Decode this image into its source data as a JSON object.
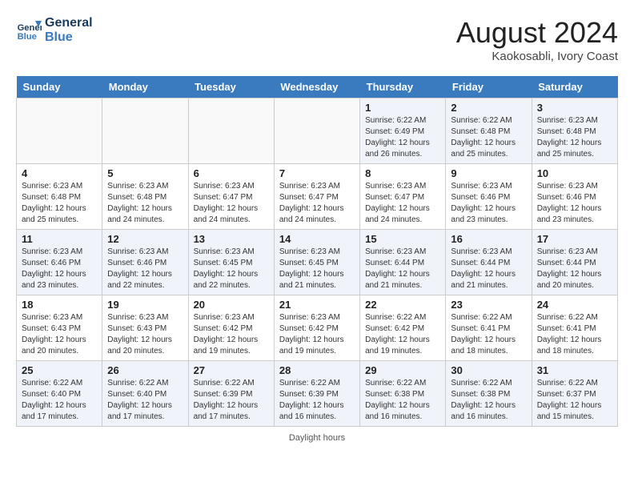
{
  "header": {
    "logo_line1": "General",
    "logo_line2": "Blue",
    "month_year": "August 2024",
    "location": "Kaokosabli, Ivory Coast"
  },
  "days_of_week": [
    "Sunday",
    "Monday",
    "Tuesday",
    "Wednesday",
    "Thursday",
    "Friday",
    "Saturday"
  ],
  "weeks": [
    [
      {
        "day": "",
        "info": ""
      },
      {
        "day": "",
        "info": ""
      },
      {
        "day": "",
        "info": ""
      },
      {
        "day": "",
        "info": ""
      },
      {
        "day": "1",
        "info": "Sunrise: 6:22 AM\nSunset: 6:49 PM\nDaylight: 12 hours\nand 26 minutes."
      },
      {
        "day": "2",
        "info": "Sunrise: 6:22 AM\nSunset: 6:48 PM\nDaylight: 12 hours\nand 25 minutes."
      },
      {
        "day": "3",
        "info": "Sunrise: 6:23 AM\nSunset: 6:48 PM\nDaylight: 12 hours\nand 25 minutes."
      }
    ],
    [
      {
        "day": "4",
        "info": "Sunrise: 6:23 AM\nSunset: 6:48 PM\nDaylight: 12 hours\nand 25 minutes."
      },
      {
        "day": "5",
        "info": "Sunrise: 6:23 AM\nSunset: 6:48 PM\nDaylight: 12 hours\nand 24 minutes."
      },
      {
        "day": "6",
        "info": "Sunrise: 6:23 AM\nSunset: 6:47 PM\nDaylight: 12 hours\nand 24 minutes."
      },
      {
        "day": "7",
        "info": "Sunrise: 6:23 AM\nSunset: 6:47 PM\nDaylight: 12 hours\nand 24 minutes."
      },
      {
        "day": "8",
        "info": "Sunrise: 6:23 AM\nSunset: 6:47 PM\nDaylight: 12 hours\nand 24 minutes."
      },
      {
        "day": "9",
        "info": "Sunrise: 6:23 AM\nSunset: 6:46 PM\nDaylight: 12 hours\nand 23 minutes."
      },
      {
        "day": "10",
        "info": "Sunrise: 6:23 AM\nSunset: 6:46 PM\nDaylight: 12 hours\nand 23 minutes."
      }
    ],
    [
      {
        "day": "11",
        "info": "Sunrise: 6:23 AM\nSunset: 6:46 PM\nDaylight: 12 hours\nand 23 minutes."
      },
      {
        "day": "12",
        "info": "Sunrise: 6:23 AM\nSunset: 6:46 PM\nDaylight: 12 hours\nand 22 minutes."
      },
      {
        "day": "13",
        "info": "Sunrise: 6:23 AM\nSunset: 6:45 PM\nDaylight: 12 hours\nand 22 minutes."
      },
      {
        "day": "14",
        "info": "Sunrise: 6:23 AM\nSunset: 6:45 PM\nDaylight: 12 hours\nand 21 minutes."
      },
      {
        "day": "15",
        "info": "Sunrise: 6:23 AM\nSunset: 6:44 PM\nDaylight: 12 hours\nand 21 minutes."
      },
      {
        "day": "16",
        "info": "Sunrise: 6:23 AM\nSunset: 6:44 PM\nDaylight: 12 hours\nand 21 minutes."
      },
      {
        "day": "17",
        "info": "Sunrise: 6:23 AM\nSunset: 6:44 PM\nDaylight: 12 hours\nand 20 minutes."
      }
    ],
    [
      {
        "day": "18",
        "info": "Sunrise: 6:23 AM\nSunset: 6:43 PM\nDaylight: 12 hours\nand 20 minutes."
      },
      {
        "day": "19",
        "info": "Sunrise: 6:23 AM\nSunset: 6:43 PM\nDaylight: 12 hours\nand 20 minutes."
      },
      {
        "day": "20",
        "info": "Sunrise: 6:23 AM\nSunset: 6:42 PM\nDaylight: 12 hours\nand 19 minutes."
      },
      {
        "day": "21",
        "info": "Sunrise: 6:23 AM\nSunset: 6:42 PM\nDaylight: 12 hours\nand 19 minutes."
      },
      {
        "day": "22",
        "info": "Sunrise: 6:22 AM\nSunset: 6:42 PM\nDaylight: 12 hours\nand 19 minutes."
      },
      {
        "day": "23",
        "info": "Sunrise: 6:22 AM\nSunset: 6:41 PM\nDaylight: 12 hours\nand 18 minutes."
      },
      {
        "day": "24",
        "info": "Sunrise: 6:22 AM\nSunset: 6:41 PM\nDaylight: 12 hours\nand 18 minutes."
      }
    ],
    [
      {
        "day": "25",
        "info": "Sunrise: 6:22 AM\nSunset: 6:40 PM\nDaylight: 12 hours\nand 17 minutes."
      },
      {
        "day": "26",
        "info": "Sunrise: 6:22 AM\nSunset: 6:40 PM\nDaylight: 12 hours\nand 17 minutes."
      },
      {
        "day": "27",
        "info": "Sunrise: 6:22 AM\nSunset: 6:39 PM\nDaylight: 12 hours\nand 17 minutes."
      },
      {
        "day": "28",
        "info": "Sunrise: 6:22 AM\nSunset: 6:39 PM\nDaylight: 12 hours\nand 16 minutes."
      },
      {
        "day": "29",
        "info": "Sunrise: 6:22 AM\nSunset: 6:38 PM\nDaylight: 12 hours\nand 16 minutes."
      },
      {
        "day": "30",
        "info": "Sunrise: 6:22 AM\nSunset: 6:38 PM\nDaylight: 12 hours\nand 16 minutes."
      },
      {
        "day": "31",
        "info": "Sunrise: 6:22 AM\nSunset: 6:37 PM\nDaylight: 12 hours\nand 15 minutes."
      }
    ]
  ],
  "footer": {
    "daylight_label": "Daylight hours"
  }
}
